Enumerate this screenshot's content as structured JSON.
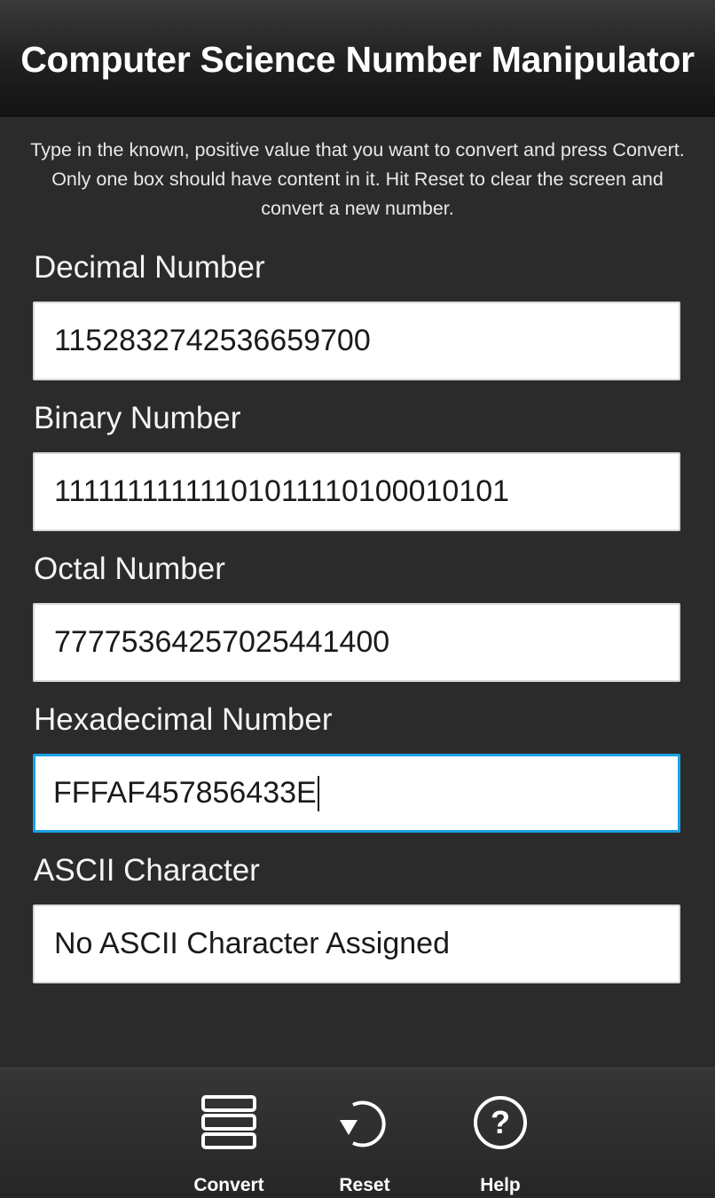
{
  "app": {
    "title": "Computer Science Number Manipulator"
  },
  "instructions": "Type in the known, positive value that you want to convert and press Convert.  Only one box should have content in it.  Hit Reset to clear the screen and convert a new number.",
  "fields": {
    "decimal": {
      "label": "Decimal Number",
      "value": "115283274253665970​0"
    },
    "binary": {
      "label": "Binary Number",
      "value": "11111111111101011110100010101"
    },
    "octal": {
      "label": "Octal Number",
      "value": "7777536425702544140​0"
    },
    "hex": {
      "label": "Hexadecimal Number",
      "value": "FFFAF457856433E",
      "focused": true
    },
    "ascii": {
      "label": "ASCII Character",
      "value": "No ASCII Character Assigned"
    }
  },
  "actions": {
    "convert": {
      "label": "Convert",
      "icon": "convert-stack-icon"
    },
    "reset": {
      "label": "Reset",
      "icon": "reset-arrow-icon"
    },
    "help": {
      "label": "Help",
      "icon": "help-question-icon"
    }
  },
  "colors": {
    "background": "#2b2b2b",
    "focus_border": "#1aa3e8",
    "text": "#f2f2f2"
  }
}
